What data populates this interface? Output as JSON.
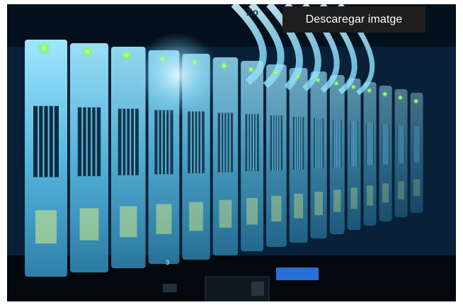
{
  "image": {
    "alt": "",
    "subject_icon": "server-rack-image"
  },
  "overlay": {
    "download_label": "Descaregar imatge"
  },
  "colors": {
    "button_bg": "#1e1e1e",
    "button_text": "#ffffff",
    "accent_cyan": "#5fd3ff",
    "led_green": "#7dff4a"
  },
  "photo_text": {
    "drive_number": "3",
    "cable_label": "Zo"
  }
}
